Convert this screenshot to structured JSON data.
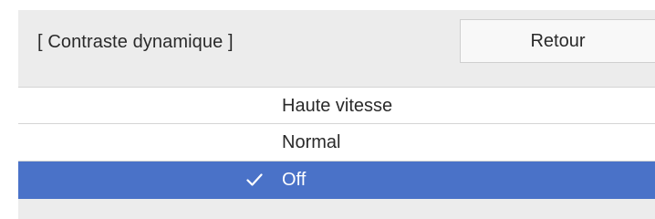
{
  "header": {
    "title": "[ Contraste dynamique ]",
    "back_label": "Retour"
  },
  "options": [
    {
      "label": "Haute vitesse",
      "selected": false
    },
    {
      "label": "Normal",
      "selected": false
    },
    {
      "label": "Off",
      "selected": true
    }
  ],
  "icons": {
    "selected_marker": "check-icon"
  },
  "colors": {
    "panel_background": "#ececec",
    "selected_background": "#4a72c8",
    "selected_text": "#ffffff"
  }
}
